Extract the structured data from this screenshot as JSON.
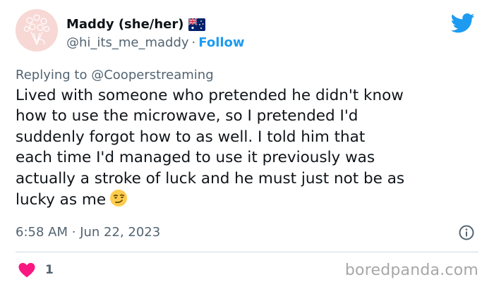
{
  "author": {
    "display_name": "Maddy (she/her)",
    "flag_icon": "australia-flag-icon",
    "handle": "@hi_its_me_maddy",
    "separator": "·",
    "follow_label": "Follow"
  },
  "platform_icon": "twitter-bird-icon",
  "reply": {
    "prefix": "Replying to",
    "handle": "@Cooperstreaming"
  },
  "tweet": {
    "text": "Lived with someone who pretended he didn't know\nhow to use the microwave, so I pretended I'd\nsuddenly forgot how to as well. I told him that\neach time I'd managed to use it previously was\nactually a stroke of luck and he must just not be as\nlucky as me",
    "emoji": "smirking-face-emoji"
  },
  "meta": {
    "time": "6:58 AM",
    "separator": "·",
    "date": "Jun 22, 2023",
    "info_icon": "info-icon"
  },
  "engagement": {
    "like_icon": "heart-icon",
    "like_count": "1"
  },
  "watermark": "boredpanda.com",
  "colors": {
    "link": "#1d9bf0",
    "secondary_text": "#536471",
    "heart": "#f91880",
    "avatar_bg": "#f7d8d5"
  }
}
